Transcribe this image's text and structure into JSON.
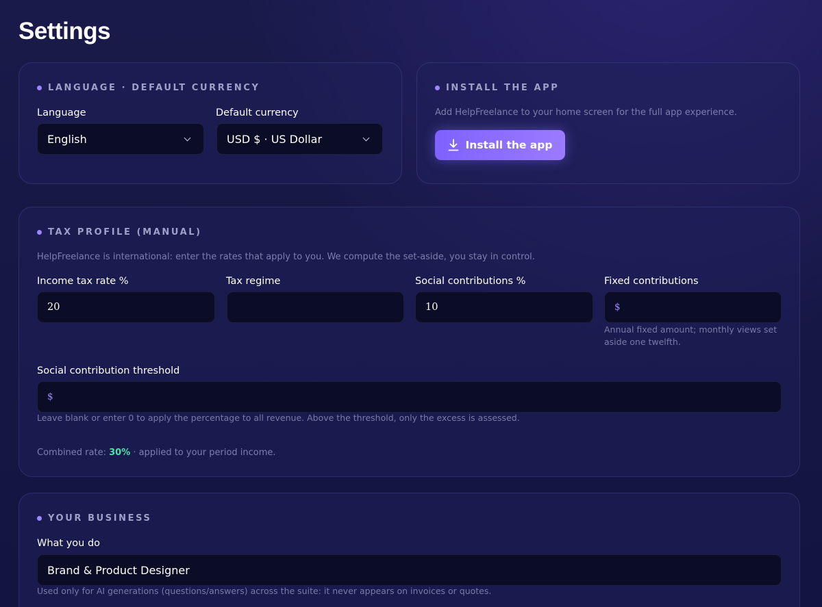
{
  "page": {
    "title": "Settings"
  },
  "language_card": {
    "title": "LANGUAGE · DEFAULT CURRENCY",
    "language_label": "Language",
    "language_value": "English",
    "currency_label": "Default currency",
    "currency_value": "USD $ · US Dollar"
  },
  "install_card": {
    "title": "INSTALL THE APP",
    "description": "Add HelpFreelance to your home screen for the full app experience.",
    "button_label": "Install the app",
    "button_icon": "download-icon"
  },
  "tax_card": {
    "title": "TAX PROFILE (MANUAL)",
    "description": "HelpFreelance is international: enter the rates that apply to you. We compute the set-aside, you stay in control.",
    "income_tax_label": "Income tax rate %",
    "income_tax_value": "20",
    "tax_regime_label": "Tax regime",
    "tax_regime_value": "",
    "social_label": "Social contributions %",
    "social_value": "10",
    "fixed_label": "Fixed contributions",
    "fixed_prefix": "$",
    "fixed_value": "",
    "fixed_hint": "Annual fixed amount; monthly views set aside one twelfth.",
    "threshold_label": "Social contribution threshold",
    "threshold_prefix": "$",
    "threshold_value": "",
    "threshold_hint": "Leave blank or enter 0 to apply the percentage to all revenue. Above the threshold, only the excess is assessed.",
    "combined_prefix": "Combined rate: ",
    "combined_rate": "30%",
    "combined_suffix": " · applied to your period income."
  },
  "business_card": {
    "title": "YOUR BUSINESS",
    "what_label": "What you do",
    "what_value": "Brand & Product Designer",
    "what_hint": "Used only for AI generations (questions/answers) across the suite: it never appears on invoices or quotes."
  },
  "colors": {
    "accent": "#9d86ff",
    "button_gradient_start": "#7f62ff",
    "button_gradient_end": "#9a7bff",
    "combined_rate": "#4ee0a4",
    "background": "#15153f",
    "field_background": "#0b0c25"
  }
}
